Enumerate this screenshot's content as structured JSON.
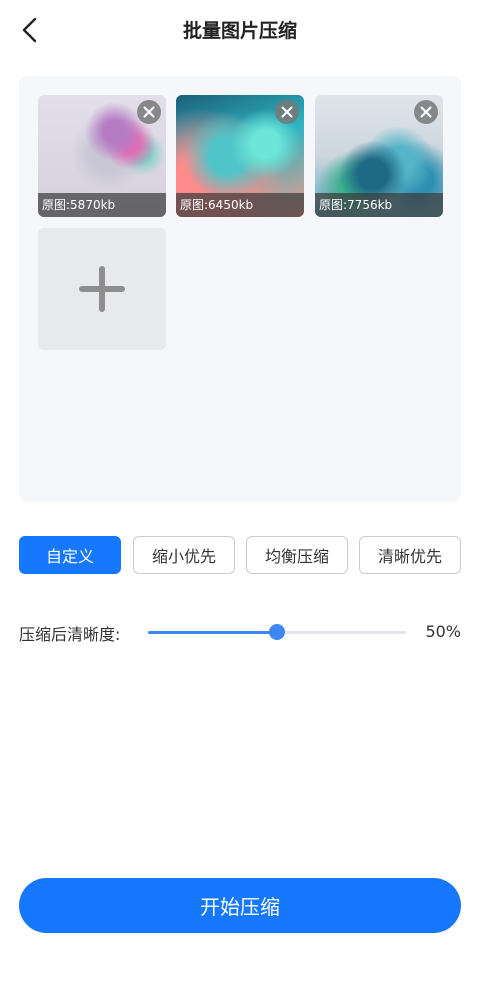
{
  "header": {
    "title": "批量图片压缩",
    "back_icon": "chevron-left-icon"
  },
  "images": [
    {
      "caption": "原图:5870kb",
      "remove_icon": "close-icon"
    },
    {
      "caption": "原图:6450kb",
      "remove_icon": "close-icon"
    },
    {
      "caption": "原图:7756kb",
      "remove_icon": "close-icon"
    }
  ],
  "add_tile": {
    "icon": "plus-icon"
  },
  "modes": [
    {
      "label": "自定义",
      "active": true
    },
    {
      "label": "缩小优先",
      "active": false
    },
    {
      "label": "均衡压缩",
      "active": false
    },
    {
      "label": "清晰优先",
      "active": false
    }
  ],
  "quality": {
    "label": "压缩后清晰度:",
    "value_text": "50%",
    "value": 0.5
  },
  "start_button": {
    "label": "开始压缩"
  },
  "colors": {
    "primary": "#1677ff",
    "slider": "#3d86f5",
    "panel_bg": "#f6f7fb"
  }
}
